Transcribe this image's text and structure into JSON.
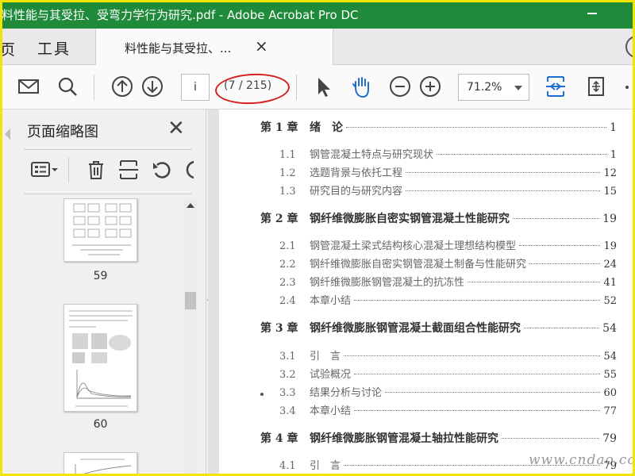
{
  "window": {
    "title": "料性能与其受拉、受弯力学行为研究.pdf - Adobe Acrobat Pro DC"
  },
  "tabs": {
    "home": "页",
    "tools": "工具",
    "doc": "料性能与其受拉、..."
  },
  "toolbar": {
    "page_input": "i",
    "page_count": "(7 / 215)",
    "zoom": "71.2%"
  },
  "thumbs_panel": {
    "title": "页面缩略图",
    "pages": [
      "59",
      "60"
    ]
  },
  "toc": [
    {
      "kind": "chapter",
      "num": "第 1 章",
      "title": "绪　论",
      "page": "1"
    },
    {
      "kind": "section",
      "num": "1.1",
      "title": "钢管混凝土特点与研究现状",
      "page": "1"
    },
    {
      "kind": "section",
      "num": "1.2",
      "title": "选题背景与依托工程",
      "page": "12"
    },
    {
      "kind": "section",
      "num": "1.3",
      "title": "研究目的与研究内容",
      "page": "15"
    },
    {
      "kind": "chapter",
      "num": "第 2 章",
      "title": "钢纤维微膨胀自密实钢管混凝土性能研究",
      "page": "19"
    },
    {
      "kind": "section",
      "num": "2.1",
      "title": "钢管混凝土梁式结构核心混凝土理想结构模型",
      "page": "19"
    },
    {
      "kind": "section",
      "num": "2.2",
      "title": "钢纤维微膨胀自密实钢管混凝土制备与性能研究",
      "page": "24"
    },
    {
      "kind": "section",
      "num": "2.3",
      "title": "钢纤维微膨胀钢管混凝土的抗冻性",
      "page": "41"
    },
    {
      "kind": "section",
      "num": "2.4",
      "title": "本章小结",
      "page": "52"
    },
    {
      "kind": "chapter",
      "num": "第 3 章",
      "title": "钢纤维微膨胀钢管混凝土截面组合性能研究",
      "page": "54"
    },
    {
      "kind": "section",
      "num": "3.1",
      "title": "引　言",
      "page": "54"
    },
    {
      "kind": "section",
      "num": "3.2",
      "title": "试验概况",
      "page": "55"
    },
    {
      "kind": "section",
      "num": "3.3",
      "title": "结果分析与讨论",
      "page": "60"
    },
    {
      "kind": "section",
      "num": "3.4",
      "title": "本章小结",
      "page": "77"
    },
    {
      "kind": "chapter",
      "num": "第 4 章",
      "title": "钢纤维微膨胀钢管混凝土轴拉性能研究",
      "page": "79"
    },
    {
      "kind": "section",
      "num": "4.1",
      "title": "引　言",
      "page": "79"
    }
  ],
  "watermark": "www.cndao.com",
  "colors": {
    "titlebar": "#1f8b3a",
    "accent": "#1f6fd1",
    "highlight_oval": "#d5201f",
    "frame": "#f2e600"
  }
}
